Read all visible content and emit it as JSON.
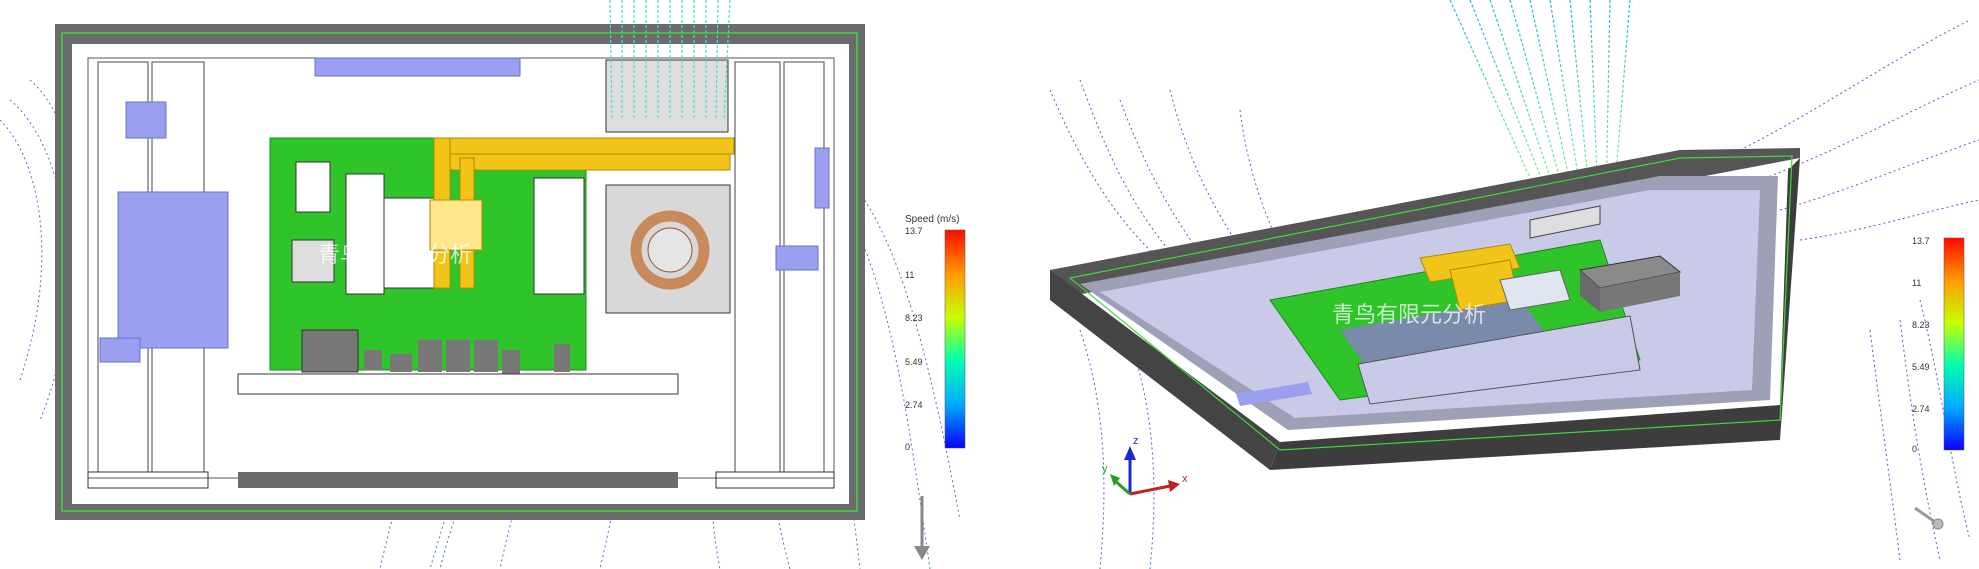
{
  "left_view": {
    "legend": {
      "title": "Speed (m/s)",
      "ticks": [
        "13.7",
        "11",
        "8.23",
        "5.49",
        "2.74",
        "0"
      ]
    },
    "watermark": "青鸟有限元分析",
    "gravity_arrow_icon": "down-arrow-icon"
  },
  "right_view": {
    "legend": {
      "title": "",
      "ticks": [
        "13.7",
        "11",
        "8.23",
        "5.49",
        "2.74",
        "0"
      ]
    },
    "watermark": "青鸟有限元分析",
    "triad": {
      "x": "x",
      "y": "y",
      "z": "z"
    },
    "triad_icon": "coordinate-triad-icon",
    "gravity_arrow_icon": "gravity-arrow-icon"
  },
  "colors": {
    "enclosure_dark": "#6b6b6b",
    "board_green": "#2fc42a",
    "heatpipe_yellow": "#f2c418",
    "fan_copper": "#c88a5a",
    "component_violet": "#9a9ff0",
    "streamline_blue": "#1a3fd0",
    "streamline_cyan": "#40e0c8"
  }
}
